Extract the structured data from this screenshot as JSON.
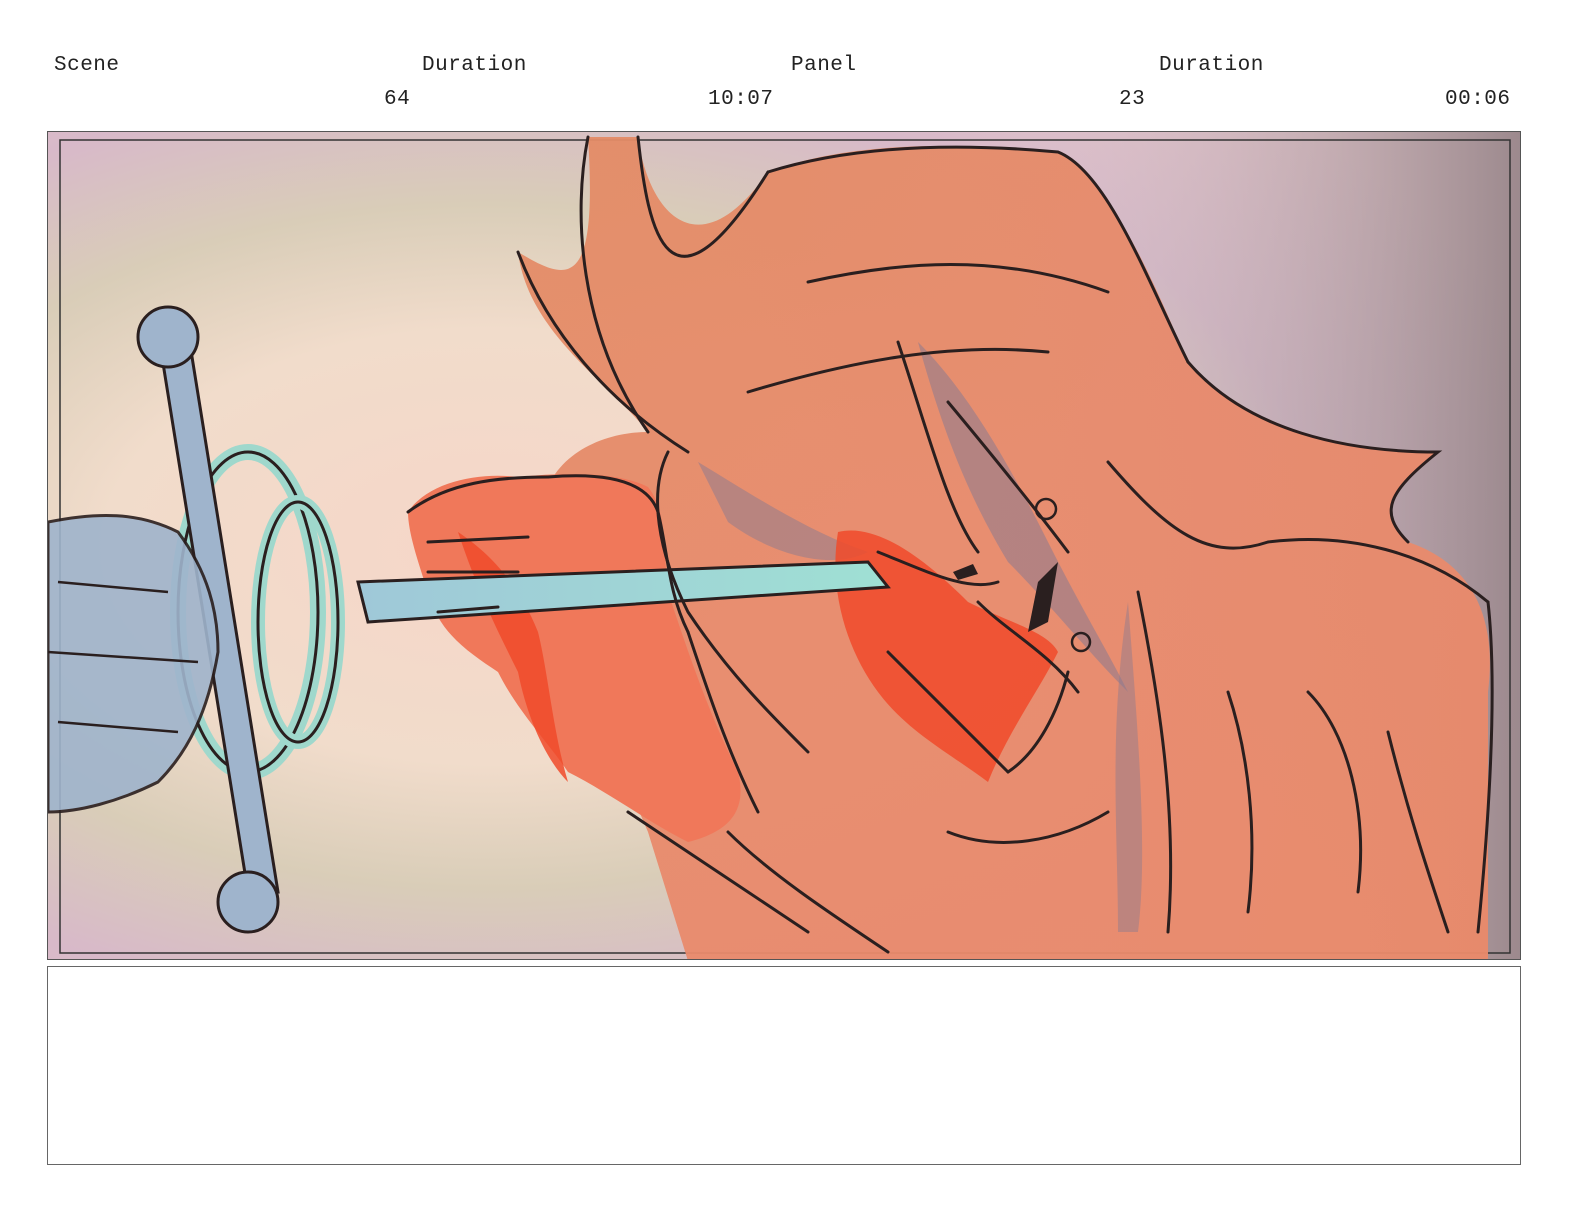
{
  "header": {
    "scene_label": "Scene",
    "scene_duration_label": "Duration",
    "panel_label": "Panel",
    "panel_duration_label": "Duration",
    "scene_number": "64",
    "scene_duration": "10:07",
    "panel_number": "23",
    "panel_duration": "00:06"
  },
  "artwork": {
    "icon": "storyboard-illustration",
    "colors": {
      "skin": "#e8876a",
      "blood": "#f04a2a",
      "sword": "#a8d8d4",
      "glove": "#9fb4cc",
      "outline": "#2a1f1f"
    }
  },
  "notes": {
    "text": ""
  }
}
